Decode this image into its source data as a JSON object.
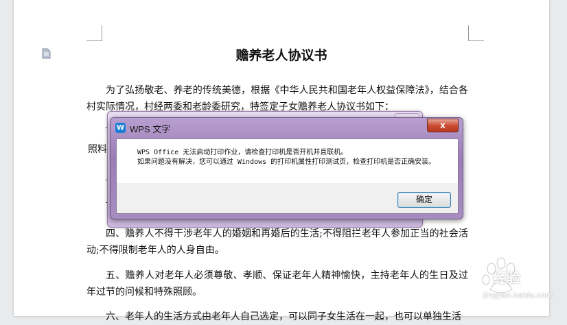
{
  "document": {
    "title": "赡养老人协议书",
    "para_intro": "为了弘扬敬老、养老的传统美德，根据《中华人民共和国老年人权益保障法》，结合各村实际情况，村经两委和老龄委研究，特签定子女赡养老人协议书如下：",
    "frag_left": "照料",
    "para_four": "四、赡养人不得干涉老年人的婚姻和再婚后的生活;不得阻拦老年人参加正当的社会活动;不得限制老年人的人身自由。",
    "para_five": "五、赡养人对老年人必须尊敬、孝顺、保证老年人精神愉快，主持老年人的生日及过年过节的问候和特殊照顾。",
    "para_six_partial": "六、老年人的生活方式由老年人自己选定，可以同子女生活在一起，也可以单独生活"
  },
  "dialog": {
    "title": "WPS 文字",
    "close_label": "x",
    "message_line1": "WPS Office 无法启动打印作业，请检查打印机是否开机并且联机。",
    "message_line2": "如果问题没有解决，您可以通过 Windows 的打印机属性打印测试页，检查打印机是否正确安装。",
    "ok_label": "确定",
    "icon": "wps-logo-icon"
  },
  "watermark": {
    "text": "经验",
    "url": "jingyan.baidu.com"
  },
  "colors": {
    "dialog_frame": "#a78dc0",
    "close_button": "#c9482f",
    "app_icon": "#1f7fd6"
  }
}
